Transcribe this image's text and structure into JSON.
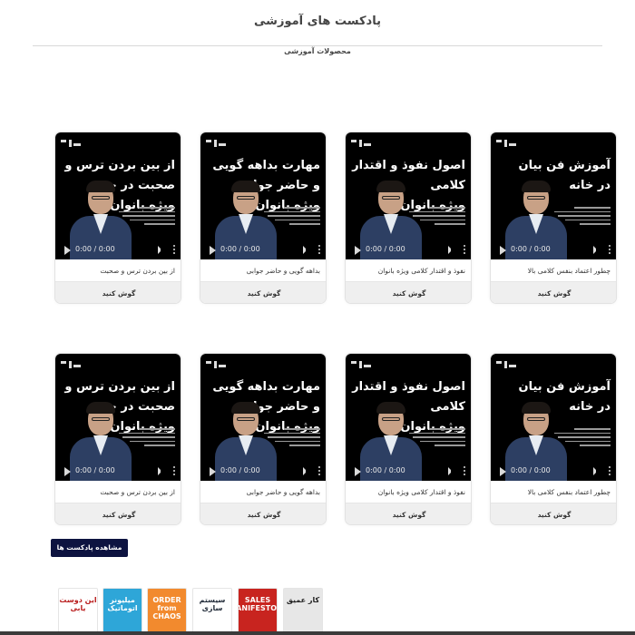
{
  "page": {
    "title": "پادکست های آموزشی",
    "section_label": "محصولات آموزشی"
  },
  "podcast_rows": [
    {
      "cards": [
        {
          "cover_title_line1": "آموزش فن بیان",
          "cover_title_line2": "در خانه",
          "caption": "چطور اعتماد بنفس کلامی بالا",
          "button": "گوش کنید",
          "time": "0:00 / 0:00"
        },
        {
          "cover_title_line1": "اصول نفوذ و اقتدار کلامی",
          "cover_title_line2": "ویژه بانوان",
          "caption": "نفوذ و اقتدار کلامی ویژه بانوان",
          "button": "گوش کنید",
          "time": "0:00 / 0:00"
        },
        {
          "cover_title_line1": "مهارت بداهه گویی و حاضر جوابی",
          "cover_title_line2": "ویژه بانوان",
          "caption": "بداهه گویی و حاضر جوابی",
          "button": "گوش کنید",
          "time": "0:00 / 0:00"
        },
        {
          "cover_title_line1": "از بین بردن ترس و",
          "cover_title_line2": "صحبت در جمع",
          "cover_title_line3": "ویژه بانوان",
          "caption": "از بین بردن ترس و صحبت",
          "button": "گوش کنید",
          "time": "0:00 / 0:00"
        }
      ]
    },
    {
      "cards": [
        {
          "cover_title_line1": "آموزش فن بیان",
          "cover_title_line2": "در خانه",
          "caption": "چطور اعتماد بنفس کلامی بالا",
          "button": "گوش کنید",
          "time": "0:00 / 0:00"
        },
        {
          "cover_title_line1": "اصول نفوذ و اقتدار کلامی",
          "cover_title_line2": "ویژه بانوان",
          "caption": "نفوذ و اقتدار کلامی ویژه بانوان",
          "button": "گوش کنید",
          "time": "0:00 / 0:00"
        },
        {
          "cover_title_line1": "مهارت بداهه گویی و حاضر جوابی",
          "cover_title_line2": "ویژه بانوان",
          "caption": "بداهه گویی و حاضر جوابی",
          "button": "گوش کنید",
          "time": "0:00 / 0:00"
        },
        {
          "cover_title_line1": "از بین بردن ترس و",
          "cover_title_line2": "صحبت در جمع",
          "cover_title_line3": "ویژه بانوان",
          "caption": "از بین بردن ترس و صحبت",
          "button": "گوش کنید",
          "time": "0:00 / 0:00"
        }
      ]
    }
  ],
  "more_button": "مشاهده پادکست ها",
  "books": [
    {
      "title": "این دوست یابی",
      "bg": "#ffffff",
      "fg": "#b91c1c"
    },
    {
      "title": "میلیونر اتوماتیک",
      "bg": "#2ea6d8",
      "fg": "#ffffff"
    },
    {
      "title": "ORDER from CHAOS",
      "bg": "#f28a2e",
      "fg": "#ffffff"
    },
    {
      "title": "سیستم سازی",
      "bg": "#ffffff",
      "fg": "#1f2937"
    },
    {
      "title": "SALES MANIFESTO",
      "bg": "#c8241f",
      "fg": "#ffffff"
    },
    {
      "title": "کار عمیق",
      "bg": "#e7e7e7",
      "fg": "#222222"
    }
  ],
  "colors": {
    "primary_button": "#0d1340",
    "cover_background": "#000000",
    "listen_button_bg": "#efefef"
  }
}
